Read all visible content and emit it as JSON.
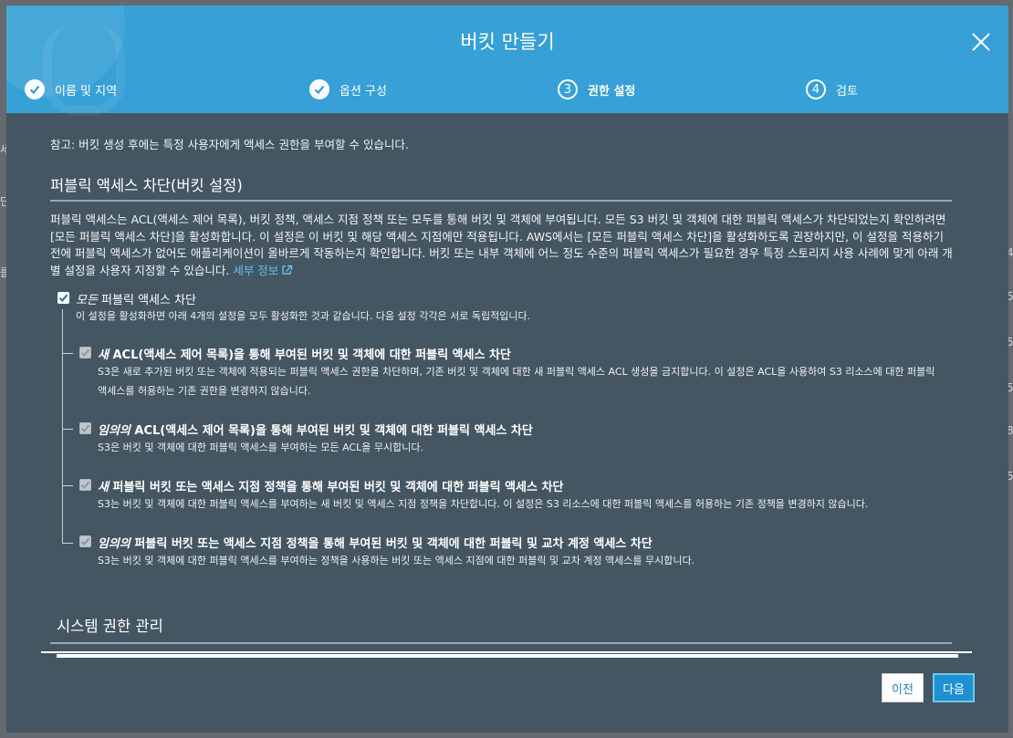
{
  "modal": {
    "title": "버킷 만들기",
    "close_icon": "close-icon"
  },
  "steps": [
    {
      "label": "이름 및 지역",
      "state": "done",
      "icon": "check-circle-icon"
    },
    {
      "label": "옵션 구성",
      "state": "done",
      "icon": "check-circle-icon"
    },
    {
      "label": "권한 설정",
      "state": "active",
      "number": "3"
    },
    {
      "label": "검토",
      "state": "pending",
      "number": "4"
    }
  ],
  "note": "참고: 버킷 생성 후에는 특정 사용자에게 액세스 권한을 부여할 수 있습니다.",
  "public_access": {
    "heading": "퍼블릭 액세스 차단(버킷 설정)",
    "description": "퍼블릭 액세스는 ACL(액세스 제어 목록), 버킷 정책, 액세스 지점 정책 또는 모두를 통해 버킷 및 객체에 부여됩니다. 모든 S3 버킷 및 객체에 대한 퍼블릭 액세스가 차단되었는지 확인하려면 [모든 퍼블릭 액세스 차단]을 활성화합니다. 이 설정은 이 버킷 및 해당 액세스 지점에만 적용됩니다. AWS에서는 [모든 퍼블릭 액세스 차단]을 활성화하도록 권장하지만, 이 설정을 적용하기 전에 퍼블릭 액세스가 없어도 애플리케이션이 올바르게 작동하는지 확인합니다. 버킷 또는 내부 객체에 어느 정도 수준의 퍼블릭 액세스가 필요한 경우 특정 스토리지 사용 사례에 맞게 아래 개별 설정을 사용자 지정할 수 있습니다.",
    "learn_more": "세부 정보",
    "block_all": {
      "emphasis": "모든",
      "label": " 퍼블릭 액세스 차단",
      "checked": true,
      "description": "이 설정을 활성화하면 아래 4개의 설정을 모두 활성화한 것과 같습니다. 다음 설정 각각은 서로 독립적입니다."
    },
    "options": [
      {
        "emphasis": "새",
        "title": " ACL(액세스 제어 목록)을 통해 부여된 버킷 및 객체에 대한 퍼블릭 액세스 차단",
        "description_line1": "S3은 새로 추가된 버킷 또는 객체에 적용되는 퍼블릭 액세스 권한을 차단하며, 기존 버킷 및 객체에 대한 새 퍼블릭 액세스 ACL 생성을 금지합니다. 이 설정은 ACL을 사용하여 S3 리소스에 대한 퍼블릭",
        "description_line2": "액세스를 허용하는 기존 권한을 변경하지 않습니다.",
        "checked": true,
        "disabled": true
      },
      {
        "emphasis": "임의의",
        "title": " ACL(액세스 제어 목록)을 통해 부여된 버킷 및 객체에 대한 퍼블릭 액세스 차단",
        "description_line1": "S3은 버킷 및 객체에 대한 퍼블릭 액세스를 부여하는 모든 ACL을 무시합니다.",
        "checked": true,
        "disabled": true
      },
      {
        "emphasis": "새",
        "title": " 퍼블릭 버킷 또는 액세스 지점 정책을 통해 부여된 버킷 및 객체에 대한 퍼블릭 액세스 차단",
        "description_line1": "S3는 버킷 및 객체에 대한 퍼블릭 액세스를 부여하는 새 버킷 및 액세스 지점 정책을 차단합니다. 이 설정은 S3 리소스에 대한 퍼블릭 액세스를 허용하는 기존 정책을 변경하지 않습니다.",
        "checked": true,
        "disabled": true
      },
      {
        "emphasis": "임의의",
        "title": " 퍼블릭 버킷 또는 액세스 지점 정책을 통해 부여된 버킷 및 객체에 대한 퍼블릭 및 교차 계정 액세스 차단",
        "description_line1": "S3는 버킷 및 객체에 대한 퍼블릭 액세스를 부여하는 정책을 사용하는 버킷 또는 액세스 지점에 대한 퍼블릭 및 교차 계정 액세스를 무시합니다.",
        "checked": true,
        "disabled": true
      }
    ]
  },
  "system_permissions": {
    "heading": "시스템 권한 관리"
  },
  "footer": {
    "prev_label": "이전",
    "next_label": "다음"
  },
  "background_fragments": [
    "세",
    "단",
    "를",
    "4",
    "5",
    "5",
    "5",
    "8",
    "5"
  ],
  "colors": {
    "header": "#37a0d6",
    "body": "#445662",
    "link": "#5cc3f0",
    "primary_button": "#1f90d0"
  }
}
